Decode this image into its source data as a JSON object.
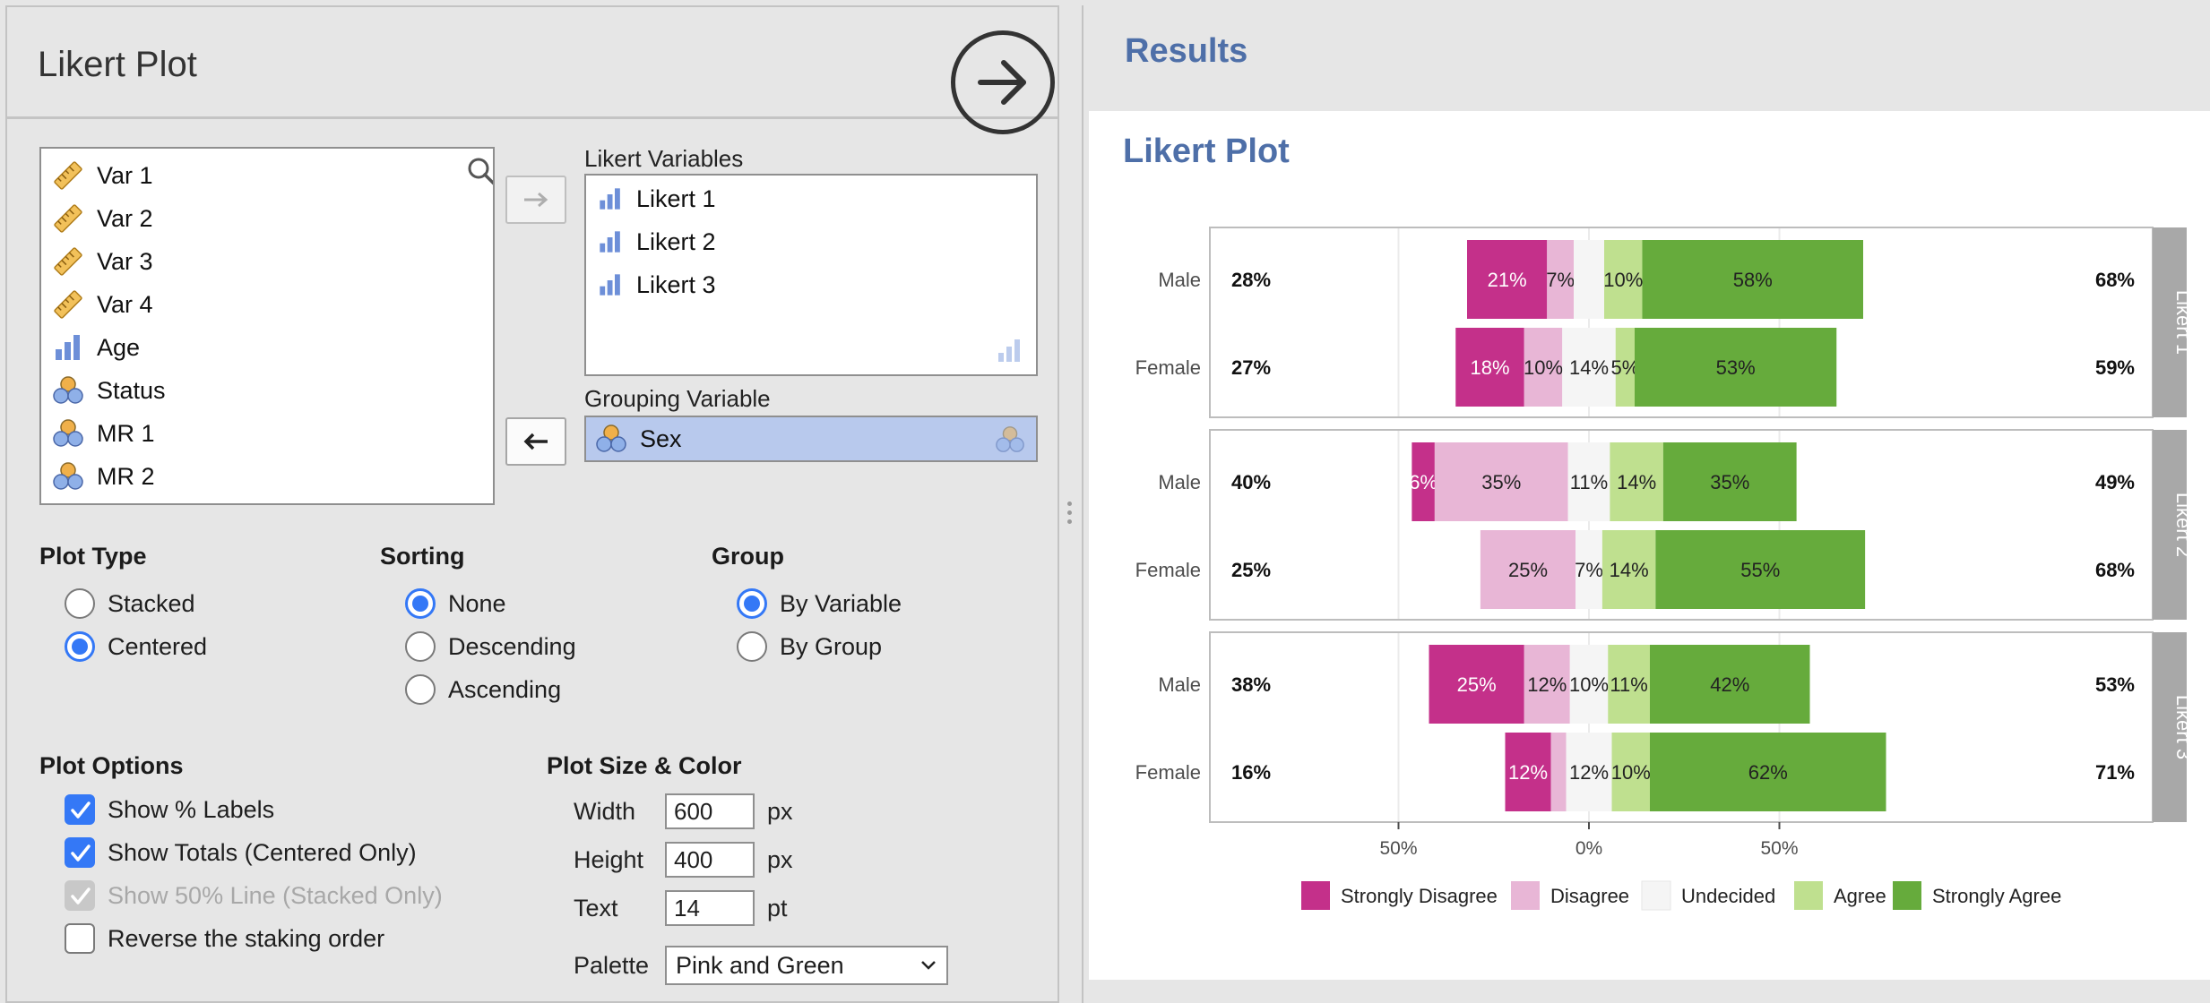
{
  "left_panel": {
    "title": "Likert Plot",
    "source_vars": [
      {
        "label": "Var 1",
        "icon": "ruler-icon"
      },
      {
        "label": "Var 2",
        "icon": "ruler-icon"
      },
      {
        "label": "Var 3",
        "icon": "ruler-icon"
      },
      {
        "label": "Var 4",
        "icon": "ruler-icon"
      },
      {
        "label": "Age",
        "icon": "ordinal-bars-icon"
      },
      {
        "label": "Status",
        "icon": "nominal-circles-icon"
      },
      {
        "label": "MR 1",
        "icon": "nominal-circles-icon"
      },
      {
        "label": "MR 2",
        "icon": "nominal-circles-icon"
      }
    ],
    "likert_label": "Likert Variables",
    "likert_vars": [
      "Likert 1",
      "Likert 2",
      "Likert 3"
    ],
    "grouping_label": "Grouping Variable",
    "grouping_var": "Sex",
    "plot_type": {
      "title": "Plot Type",
      "options": [
        "Stacked",
        "Centered"
      ],
      "selected": "Centered"
    },
    "sorting": {
      "title": "Sorting",
      "options": [
        "None",
        "Descending",
        "Ascending"
      ],
      "selected": "None"
    },
    "group": {
      "title": "Group",
      "options": [
        "By Variable",
        "By Group"
      ],
      "selected": "By Variable"
    },
    "plot_options": {
      "title": "Plot Options",
      "show_pct_labels": {
        "label": "Show % Labels",
        "checked": true
      },
      "show_totals": {
        "label": "Show Totals (Centered Only)",
        "checked": true
      },
      "show_50_line": {
        "label": "Show 50% Line (Stacked Only)",
        "checked": true,
        "disabled": true
      },
      "reverse_order": {
        "label": "Reverse the staking order",
        "checked": false
      }
    },
    "size_color": {
      "title": "Plot Size & Color",
      "width_label": "Width",
      "width": "600",
      "width_unit": "px",
      "height_label": "Height",
      "height": "400",
      "height_unit": "px",
      "text_label": "Text",
      "text": "14",
      "text_unit": "pt",
      "palette_label": "Palette",
      "palette": "Pink and Green"
    }
  },
  "results": {
    "title": "Results",
    "plot_title": "Likert Plot"
  },
  "chart_data": {
    "type": "bar",
    "orientation": "horizontal-diverging-stacked",
    "categories": [
      "Strongly Disagree",
      "Disagree",
      "Undecided",
      "Agree",
      "Strongly Agree"
    ],
    "colors": [
      "#c4308a",
      "#e8b6d6",
      "#f5f5f5",
      "#bfe08f",
      "#66ab3c"
    ],
    "label_colors": [
      "#ffffff",
      "#222222",
      "#222222",
      "#222222",
      "#222222"
    ],
    "x_ticks": [
      -50,
      0,
      50
    ],
    "x_tick_labels": [
      "50%",
      "0%",
      "50%"
    ],
    "xlim": [
      -50,
      95
    ],
    "panels": [
      {
        "name": "Likert 1",
        "rows": [
          {
            "group": "Male",
            "left_total": "28%",
            "right_total": "68%",
            "values": [
              21,
              7,
              8,
              10,
              58
            ],
            "labels": [
              "21%",
              "7%",
              "",
              "10%",
              "58%"
            ]
          },
          {
            "group": "Female",
            "left_total": "27%",
            "right_total": "59%",
            "values": [
              18,
              10,
              14,
              5,
              53
            ],
            "labels": [
              "18%",
              "10%",
              "14%",
              "5%",
              "53%"
            ]
          }
        ]
      },
      {
        "name": "Likert 2",
        "rows": [
          {
            "group": "Male",
            "left_total": "40%",
            "right_total": "49%",
            "values": [
              6,
              35,
              11,
              14,
              35
            ],
            "labels": [
              "6%",
              "35%",
              "11%",
              "14%",
              "35%"
            ]
          },
          {
            "group": "Female",
            "left_total": "25%",
            "right_total": "68%",
            "values": [
              0,
              25,
              7,
              14,
              55
            ],
            "labels": [
              "",
              "25%",
              "7%",
              "14%",
              "55%"
            ]
          }
        ]
      },
      {
        "name": "Likert 3",
        "rows": [
          {
            "group": "Male",
            "left_total": "38%",
            "right_total": "53%",
            "values": [
              25,
              12,
              10,
              11,
              42
            ],
            "labels": [
              "25%",
              "12%",
              "10%",
              "11%",
              "42%"
            ]
          },
          {
            "group": "Female",
            "left_total": "16%",
            "right_total": "71%",
            "values": [
              12,
              4,
              12,
              10,
              62
            ],
            "labels": [
              "12%",
              "",
              "12%",
              "10%",
              "62%"
            ]
          }
        ]
      }
    ],
    "legend_position": "bottom",
    "grid": true
  }
}
